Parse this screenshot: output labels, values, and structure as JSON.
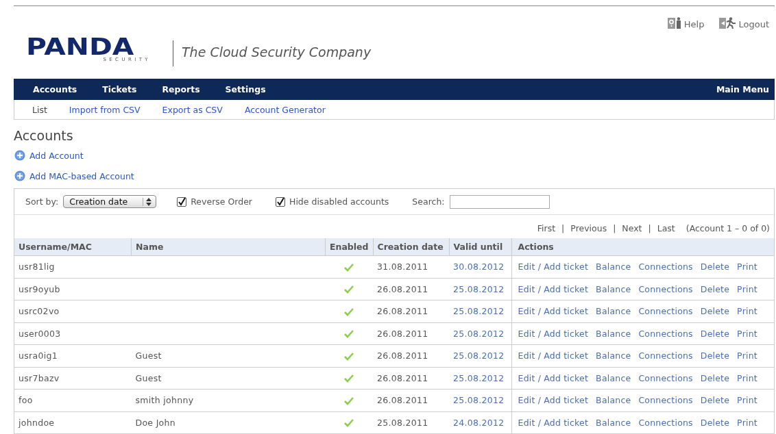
{
  "header": {
    "logo": {
      "brand": "PANDA",
      "sub": "SECURITY"
    },
    "tagline": "The Cloud Security Company",
    "links": [
      {
        "kind": "help",
        "label": "Help"
      },
      {
        "kind": "logout",
        "label": "Logout"
      }
    ]
  },
  "nav": {
    "items": [
      "Accounts",
      "Tickets",
      "Reports",
      "Settings"
    ],
    "right": "Main Menu"
  },
  "subnav": [
    {
      "label": "List",
      "selected": true
    },
    {
      "label": "Import from CSV",
      "selected": false
    },
    {
      "label": "Export as CSV",
      "selected": false
    },
    {
      "label": "Account Generator",
      "selected": false
    }
  ],
  "page_title": "Accounts",
  "add_links": [
    "Add Account",
    "Add MAC-based Account"
  ],
  "toolbar": {
    "sort_label": "Sort by:",
    "sort_value": "Creation date",
    "checkboxes": [
      {
        "label": "Reverse Order",
        "checked": true
      },
      {
        "label": "Hide disabled accounts",
        "checked": true
      }
    ],
    "search_label": "Search:"
  },
  "pagination": {
    "links": [
      "First",
      "Previous",
      "Next",
      "Last"
    ],
    "separator": "|",
    "summary": "(Account 1 – 0 of 0)"
  },
  "table": {
    "columns": [
      "Username/MAC",
      "Name",
      "Enabled",
      "Creation date",
      "Valid until",
      "Actions"
    ],
    "rows": [
      {
        "username": "usr81lig",
        "name": "",
        "enabled": true,
        "created": "31.08.2011",
        "valid_until": "30.08.2012",
        "actions": [
          "Edit / Add ticket",
          "Balance",
          "Connections",
          "Delete",
          "Print"
        ]
      },
      {
        "username": "usr9oyub",
        "name": "",
        "enabled": true,
        "created": "26.08.2011",
        "valid_until": "25.08.2012",
        "actions": [
          "Edit / Add ticket",
          "Balance",
          "Connections",
          "Delete",
          "Print"
        ]
      },
      {
        "username": "usrc02vo",
        "name": "",
        "enabled": true,
        "created": "26.08.2011",
        "valid_until": "25.08.2012",
        "actions": [
          "Edit / Add ticket",
          "Balance",
          "Connections",
          "Delete",
          "Print"
        ]
      },
      {
        "username": "user0003",
        "name": "",
        "enabled": true,
        "created": "26.08.2011",
        "valid_until": "25.08.2012",
        "actions": [
          "Edit / Add ticket",
          "Balance",
          "Connections",
          "Delete",
          "Print"
        ]
      },
      {
        "username": "usra0ig1",
        "name": "Guest",
        "enabled": true,
        "created": "26.08.2011",
        "valid_until": "25.08.2012",
        "actions": [
          "Edit / Add ticket",
          "Balance",
          "Connections",
          "Delete",
          "Print"
        ]
      },
      {
        "username": "usr7bazv",
        "name": "Guest",
        "enabled": true,
        "created": "26.08.2011",
        "valid_until": "25.08.2012",
        "actions": [
          "Edit / Add ticket",
          "Balance",
          "Connections",
          "Delete",
          "Print"
        ]
      },
      {
        "username": "foo",
        "name": "smith johnny",
        "enabled": true,
        "created": "26.08.2011",
        "valid_until": "25.08.2012",
        "actions": [
          "Edit / Add ticket",
          "Balance",
          "Connections",
          "Delete",
          "Print"
        ]
      },
      {
        "username": "johndoe",
        "name": "Doe John",
        "enabled": true,
        "created": "25.08.2011",
        "valid_until": "24.08.2012",
        "actions": [
          "Edit / Add ticket",
          "Balance",
          "Connections",
          "Delete",
          "Print"
        ]
      }
    ]
  }
}
